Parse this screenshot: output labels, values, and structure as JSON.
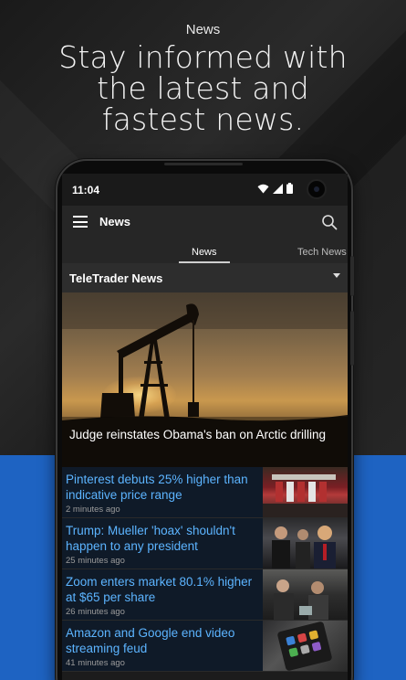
{
  "promo": {
    "label": "News",
    "headline_lines": [
      "Stay informed with",
      "the latest and",
      "fastest news."
    ]
  },
  "status_bar": {
    "time": "11:04",
    "icons": [
      "wifi-icon",
      "signal-icon",
      "battery-icon"
    ]
  },
  "app_bar": {
    "title": "News",
    "menu_icon": "hamburger-menu-icon",
    "search_icon": "search-icon"
  },
  "tabs": [
    {
      "label": "News",
      "selected": true
    },
    {
      "label": "Tech News",
      "selected": false
    }
  ],
  "source_selector": {
    "selected": "TeleTrader News"
  },
  "featured": {
    "image": "oil-pumpjack-sunset",
    "title": "Judge reinstates Obama's ban on Arctic drilling"
  },
  "news_items": [
    {
      "title": "Pinterest debuts 25% higher than indicative price range",
      "time": "2 minutes ago",
      "thumbnail": "stock-exchange-flags"
    },
    {
      "title": "Trump: Mueller 'hoax' shouldn't happen to any president",
      "time": "25 minutes ago",
      "thumbnail": "president-speaking"
    },
    {
      "title": "Zoom enters market 80.1% higher at $65 per share",
      "time": "26 minutes ago",
      "thumbnail": "market-traders"
    },
    {
      "title": "Amazon and Google end video streaming feud",
      "time": "41 minutes ago",
      "thumbnail": "smartphone-apps"
    }
  ],
  "colors": {
    "link_blue": "#5cb4ff",
    "bottom_band": "#1e63c2",
    "app_bar": "#262626"
  }
}
